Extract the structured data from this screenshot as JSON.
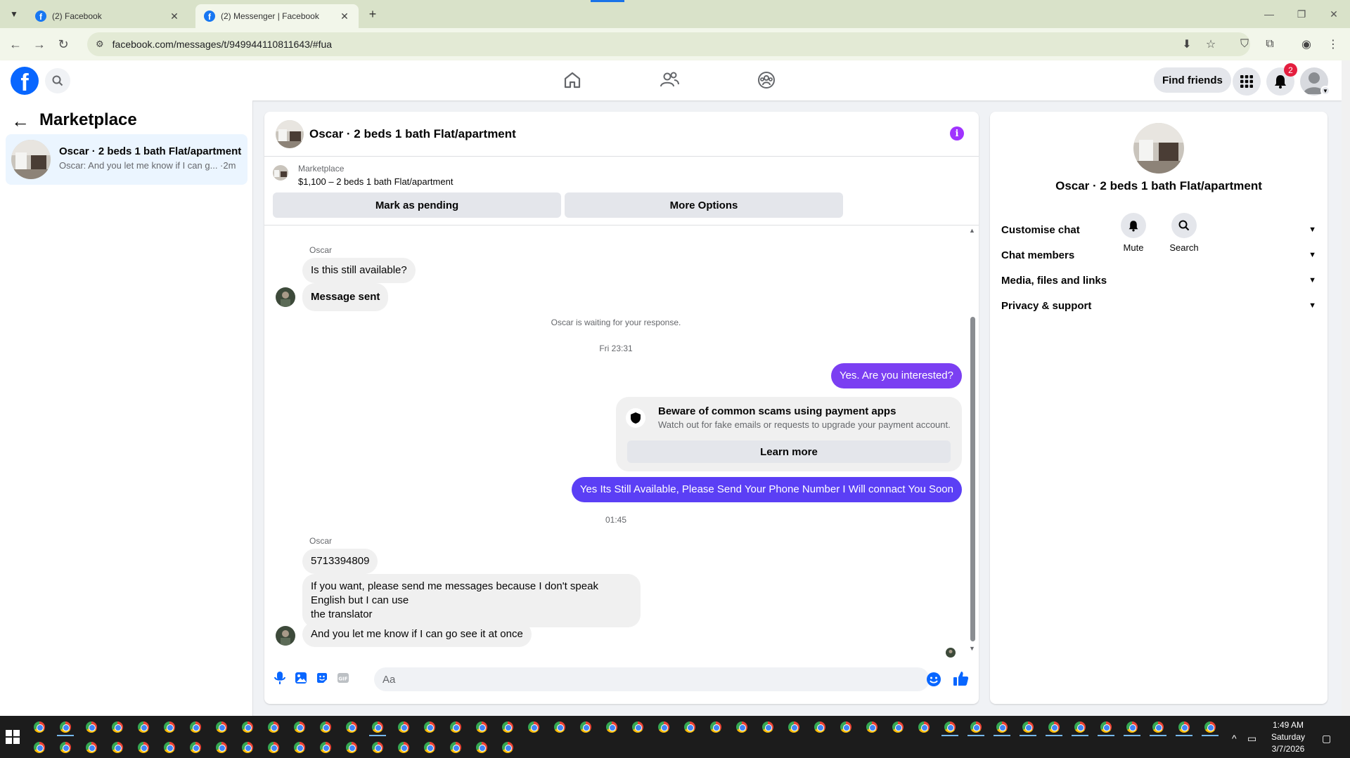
{
  "browser": {
    "tabs": [
      {
        "title": "(2) Facebook",
        "active": false
      },
      {
        "title": "(2) Messenger | Facebook",
        "active": true
      }
    ],
    "url": "facebook.com/messages/t/949944110811643/#fua"
  },
  "header": {
    "find_friends": "Find friends",
    "notification_count": "2"
  },
  "sidebar": {
    "title": "Marketplace",
    "conversations": [
      {
        "name": "Oscar · 2 beds 1 bath Flat/apartment",
        "preview": "Oscar: And you let me know if I can g... ·2m"
      }
    ]
  },
  "chat": {
    "title": "Oscar · 2 beds 1 bath Flat/apartment",
    "listing": {
      "label": "Marketplace",
      "price_title": "$1,100 – 2 beds 1 bath Flat/apartment",
      "pending_button": "Mark as pending",
      "options_button": "More Options"
    },
    "messages": {
      "sender_1": "Oscar",
      "m1": "Is this still available?",
      "m2": "Message sent",
      "waiting": "Oscar is waiting for your response.",
      "time_1": "Fri 23:31",
      "out_1": "Yes. Are you interested?",
      "scam_title": "Beware of common scams using payment apps",
      "scam_sub": "Watch out for fake emails or requests to upgrade your payment account.",
      "learn_more": "Learn more",
      "out_2": "Yes Its Still Available, Please Send Your Phone Number I Will connact You Soon",
      "time_2": "01:45",
      "sender_2": "Oscar",
      "m3": "5713394809",
      "m4_line1": "If you want, please send me messages because I don't speak English but I can use",
      "m4_line2": "the translator",
      "m5": "And you let me know if I can go see it at once"
    },
    "composer_placeholder": "Aa"
  },
  "info_panel": {
    "name": "Oscar · 2 beds 1 bath Flat/apartment",
    "mute": "Mute",
    "search": "Search",
    "sections": [
      "Customise chat",
      "Chat members",
      "Media, files and links",
      "Privacy & support"
    ]
  },
  "taskbar": {
    "time": "1:49 AM",
    "day": "Saturday",
    "date": "3/7/2026"
  },
  "colors": {
    "fb_blue": "#0866ff",
    "bubble_out_purple": "#7b3ff2",
    "bubble_out_blue": "#5b3ff5",
    "info_purple": "#a033ff",
    "badge_red": "#e41e3f"
  }
}
